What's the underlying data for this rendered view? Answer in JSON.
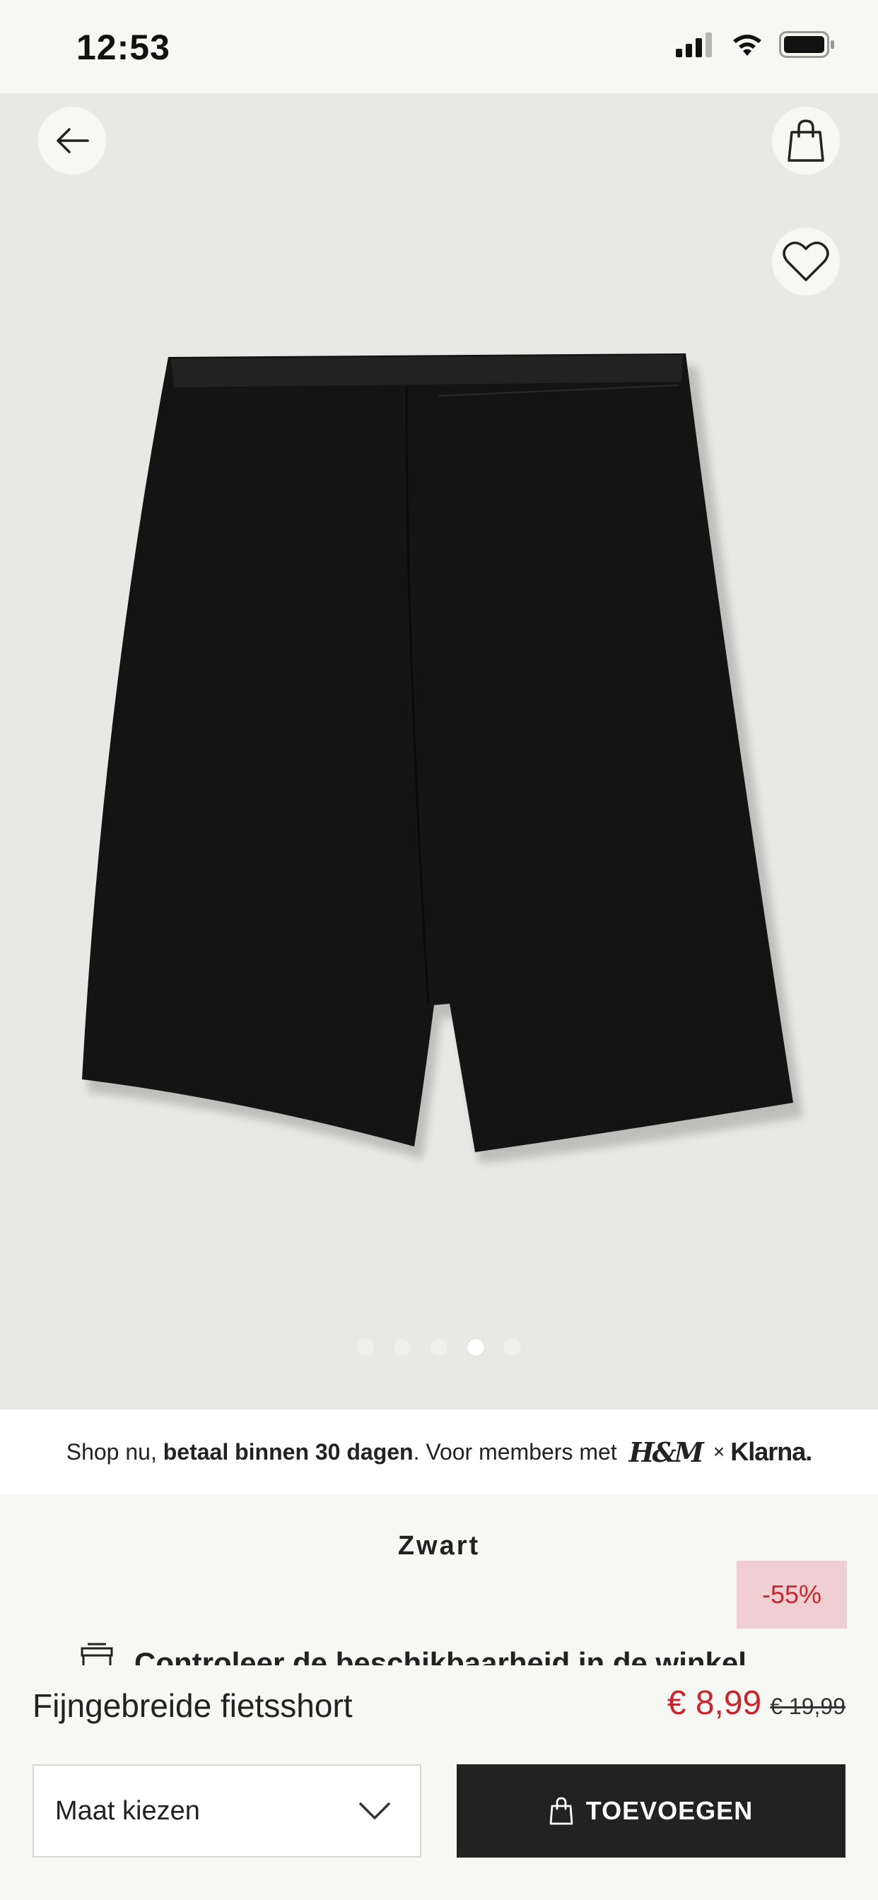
{
  "status_bar": {
    "time": "12:53",
    "icons": [
      "cellular-signal-icon",
      "wifi-icon",
      "battery-icon"
    ]
  },
  "gallery": {
    "image_count": 5,
    "active_index": 3,
    "buttons": [
      "back-arrow-icon",
      "shopping-bag-icon",
      "heart-icon"
    ]
  },
  "klarna_banner": {
    "prefix": "Shop nu, ",
    "bold": "betaal binnen 30 dagen",
    "suffix": ". Voor members met ",
    "hm_logo": "H&M",
    "times": "×",
    "klarna_logo": "Klarna."
  },
  "product": {
    "color": "Zwart",
    "discount": "-55%",
    "store_check": "Controleer de beschikbaarheid in de winkel",
    "name": "Fijngebreide fietsshort",
    "price": "€ 8,99",
    "old_price": "€ 19,99"
  },
  "actions": {
    "size_label": "Maat kiezen",
    "add_label": "TOEVOEGEN"
  },
  "colors": {
    "sale_red": "#c8262e",
    "badge_bg": "#f0cfd2",
    "button_dark": "#222222",
    "image_bg": "#e8e8e5"
  }
}
